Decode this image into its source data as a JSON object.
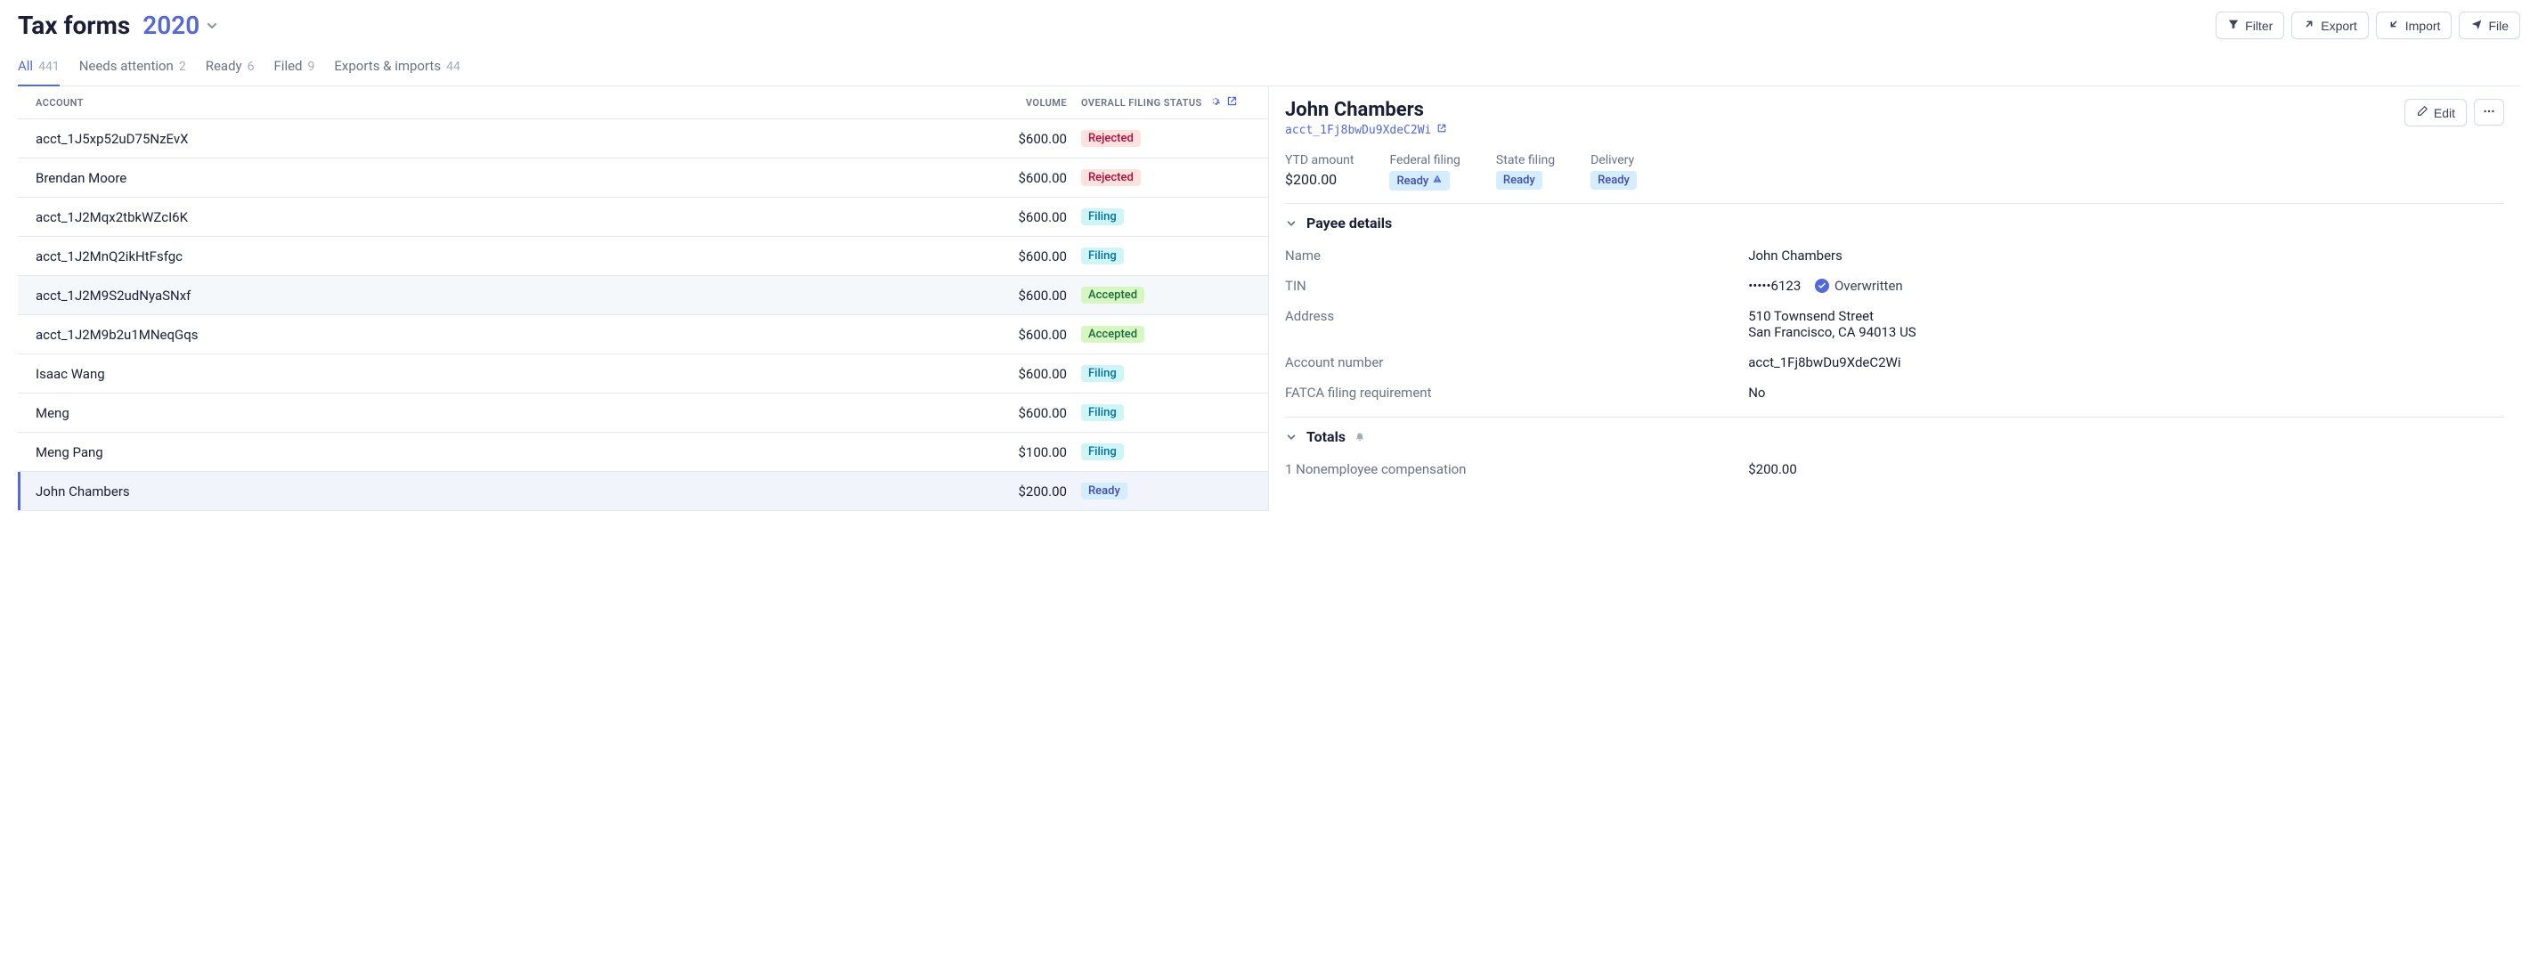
{
  "header": {
    "title": "Tax forms",
    "year": "2020",
    "buttons": {
      "filter": "Filter",
      "export": "Export",
      "import": "Import",
      "file": "File"
    }
  },
  "tabs": [
    {
      "label": "All",
      "count": "441",
      "active": true
    },
    {
      "label": "Needs attention",
      "count": "2"
    },
    {
      "label": "Ready",
      "count": "6"
    },
    {
      "label": "Filed",
      "count": "9"
    },
    {
      "label": "Exports & imports",
      "count": "44"
    }
  ],
  "columns": {
    "account": "Account",
    "volume": "Volume",
    "status": "Overall filing status"
  },
  "rows": [
    {
      "account": "acct_1J5xp52uD75NzEvX",
      "volume": "$600.00",
      "status": "Rejected",
      "status_class": "rejected"
    },
    {
      "account": "Brendan Moore",
      "volume": "$600.00",
      "status": "Rejected",
      "status_class": "rejected"
    },
    {
      "account": "acct_1J2Mqx2tbkWZcI6K",
      "volume": "$600.00",
      "status": "Filing",
      "status_class": "filing"
    },
    {
      "account": "acct_1J2MnQ2ikHtFsfgc",
      "volume": "$600.00",
      "status": "Filing",
      "status_class": "filing"
    },
    {
      "account": "acct_1J2M9S2udNyaSNxf",
      "volume": "$600.00",
      "status": "Accepted",
      "status_class": "accepted",
      "hl": true
    },
    {
      "account": "acct_1J2M9b2u1MNeqGqs",
      "volume": "$600.00",
      "status": "Accepted",
      "status_class": "accepted"
    },
    {
      "account": "Isaac Wang",
      "volume": "$600.00",
      "status": "Filing",
      "status_class": "filing"
    },
    {
      "account": "Meng",
      "volume": "$600.00",
      "status": "Filing",
      "status_class": "filing"
    },
    {
      "account": "Meng Pang",
      "volume": "$100.00",
      "status": "Filing",
      "status_class": "filing"
    },
    {
      "account": "John Chambers",
      "volume": "$200.00",
      "status": "Ready",
      "status_class": "ready",
      "selected": true
    }
  ],
  "detail": {
    "name": "John Chambers",
    "account_id": "acct_1Fj8bwDu9XdeC2Wi",
    "edit_label": "Edit",
    "summary": {
      "ytd_label": "YTD amount",
      "ytd_value": "$200.00",
      "federal_label": "Federal filing",
      "federal_value": "Ready",
      "state_label": "State filing",
      "state_value": "Ready",
      "delivery_label": "Delivery",
      "delivery_value": "Ready"
    },
    "payee_section_title": "Payee details",
    "payee": {
      "name_label": "Name",
      "name_value": "John Chambers",
      "tin_label": "TIN",
      "tin_value": "•••••6123",
      "tin_note": "Overwritten",
      "address_label": "Address",
      "address_line1": "510 Townsend Street",
      "address_line2": "San Francisco, CA 94013 US",
      "acct_label": "Account number",
      "acct_value": "acct_1Fj8bwDu9XdeC2Wi",
      "fatca_label": "FATCA filing requirement",
      "fatca_value": "No"
    },
    "totals_section_title": "Totals",
    "totals": {
      "row1_label": "1 Nonemployee compensation",
      "row1_value": "$200.00"
    }
  }
}
